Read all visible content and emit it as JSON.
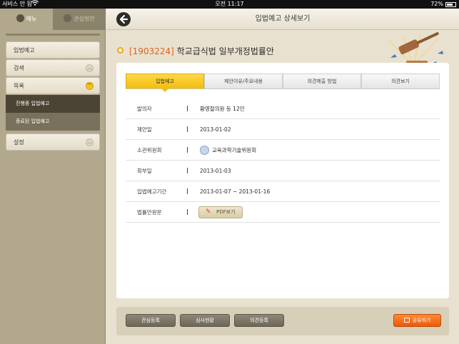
{
  "status_bar": {
    "carrier": "서비스 안 됨",
    "time": "오전 11:17",
    "battery": "72%",
    "battery_level": 0.72
  },
  "sidebar": {
    "tabs": [
      {
        "label": "메뉴",
        "icon": "menu-icon",
        "active": true
      },
      {
        "label": "관심법안",
        "icon": "profile-icon",
        "active": false
      }
    ],
    "items": [
      {
        "label": "입법예고"
      },
      {
        "label": "검색",
        "chevron": "collapsed"
      },
      {
        "label": "목록",
        "chevron": "expanded"
      },
      {
        "label": "설정",
        "chevron": "collapsed"
      }
    ],
    "subitems": [
      {
        "label": "진행중 입법예고",
        "active": true
      },
      {
        "label": "종료된 입법예고",
        "active": false
      }
    ]
  },
  "header": {
    "title": "입법예고 상세보기",
    "back_icon": "arrow-left-icon"
  },
  "bill": {
    "number": "[1903224]",
    "title": "학교급식법 일부개정법률안"
  },
  "tabs": [
    "입법예고",
    "제안이유/주요내용",
    "의견제출 방법",
    "의견보기"
  ],
  "details": {
    "proposer_label": "발의자",
    "proposer": "황영철의원 등 12인",
    "proposed_date_label": "제안일",
    "proposed_date": "2013-01-02",
    "committee_label": "소관위원회",
    "committee": "교육과학기술위원회",
    "referral_date_label": "회부일",
    "referral_date": "2013-01-03",
    "notice_period_label": "입법예고기간",
    "notice_period": "2013-01-07 ~ 2013-01-16",
    "bill_text_label": "법률안원문",
    "pdf_button": "PDF보기"
  },
  "actions": {
    "interest": "관심등록",
    "review_status": "심사현황",
    "register_opinion": "의견등록",
    "share": "공유하기"
  },
  "colors": {
    "accent": "#f4bc0b",
    "bill_number": "#e0651a",
    "share": "#ea5a0b"
  }
}
